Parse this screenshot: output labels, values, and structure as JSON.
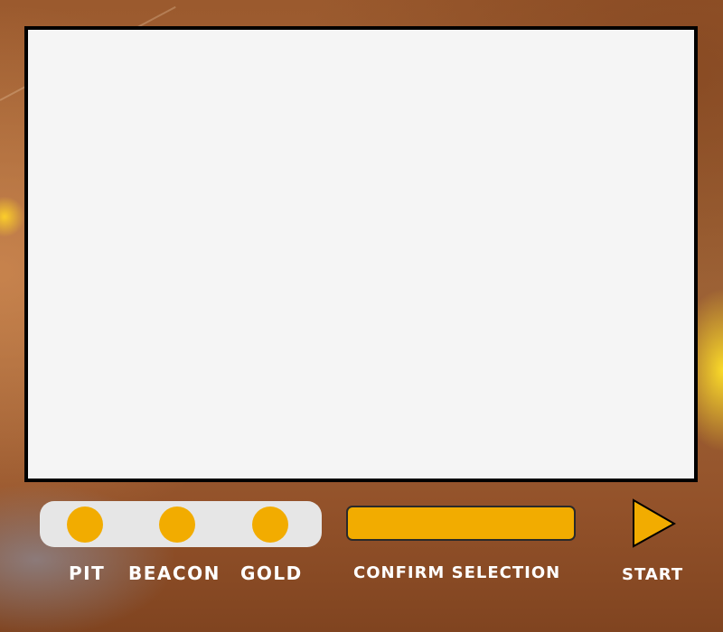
{
  "colors": {
    "accent": "#f2ac00",
    "panel": "#f5f5f5",
    "selector_background": "#e6e6e6",
    "label_text": "#ffffff"
  },
  "mode_selector": {
    "options": [
      {
        "label": "PIT",
        "icon": "circle-icon"
      },
      {
        "label": "BEACON",
        "icon": "circle-icon"
      },
      {
        "label": "GOLD",
        "icon": "circle-icon"
      }
    ]
  },
  "confirm": {
    "label": "CONFIRM SELECTION"
  },
  "start": {
    "label": "START",
    "icon": "play-triangle-icon"
  }
}
